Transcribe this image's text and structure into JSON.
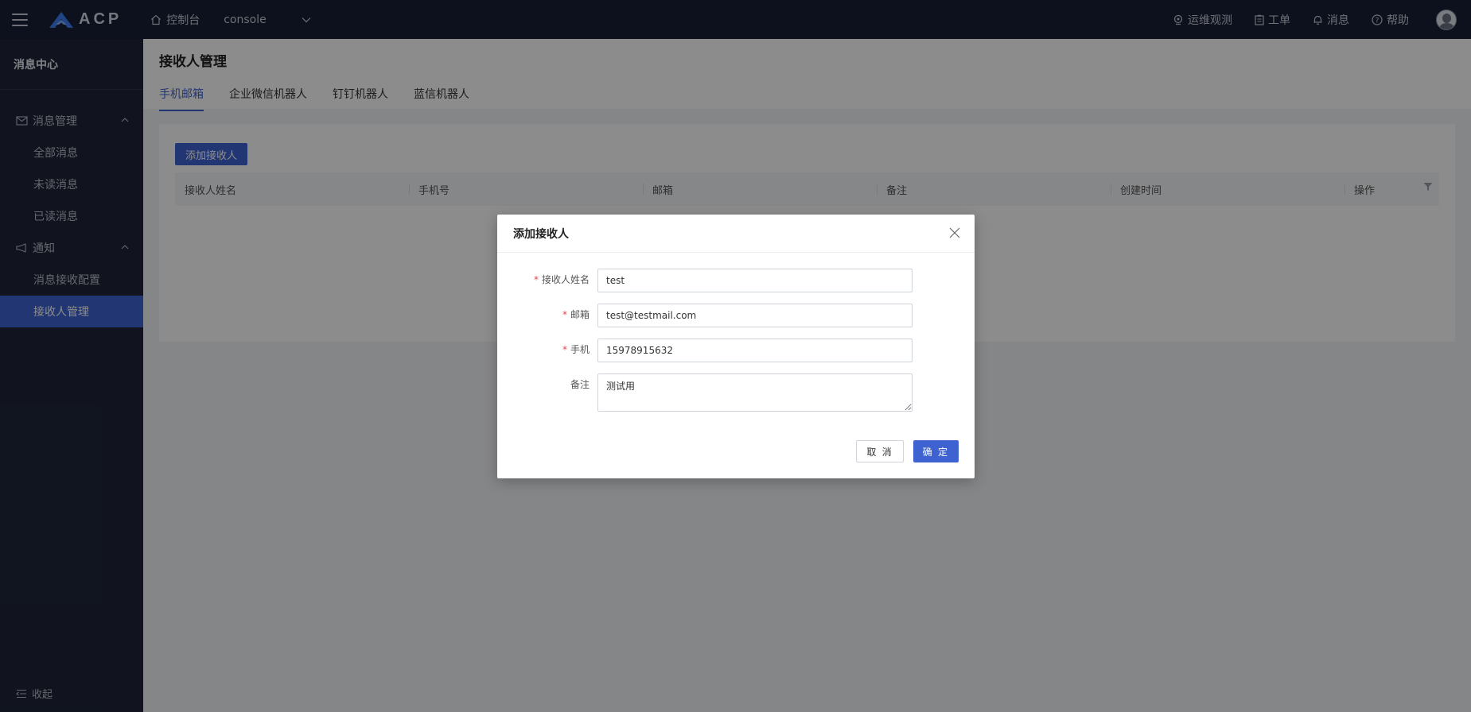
{
  "topbar": {
    "logo_text": "ACP",
    "console_label": "控制台",
    "project": "console",
    "right_items": [
      "运维观测",
      "工单",
      "消息",
      "帮助"
    ]
  },
  "sidebar": {
    "title": "消息中心",
    "groups": [
      {
        "label": "消息管理",
        "items": [
          "全部消息",
          "未读消息",
          "已读消息"
        ]
      },
      {
        "label": "通知",
        "items": [
          "消息接收配置",
          "接收人管理"
        ]
      }
    ],
    "active_item": "接收人管理",
    "collapse_label": "收起"
  },
  "page": {
    "title": "接收人管理",
    "tabs": [
      "手机邮箱",
      "企业微信机器人",
      "钉钉机器人",
      "蓝信机器人"
    ],
    "active_tab": "手机邮箱",
    "add_button": "添加接收人",
    "columns": [
      "接收人姓名",
      "手机号",
      "邮箱",
      "备注",
      "创建时间",
      "操作"
    ]
  },
  "dialog": {
    "title": "添加接收人",
    "fields": {
      "name": {
        "label": "接收人姓名",
        "value": "test",
        "required": true
      },
      "email": {
        "label": "邮箱",
        "value": "test@testmail.com",
        "required": true
      },
      "phone": {
        "label": "手机",
        "value": "15978915632",
        "required": true
      },
      "remark": {
        "label": "备注",
        "value": "测试用",
        "required": false
      }
    },
    "required_mark": "*",
    "cancel_label": "取 消",
    "ok_label": "确 定"
  },
  "colors": {
    "topbar_bg": "#182035",
    "sidebar_bg": "#1f2638",
    "accent": "#3e63d1",
    "required": "#e5484d"
  }
}
